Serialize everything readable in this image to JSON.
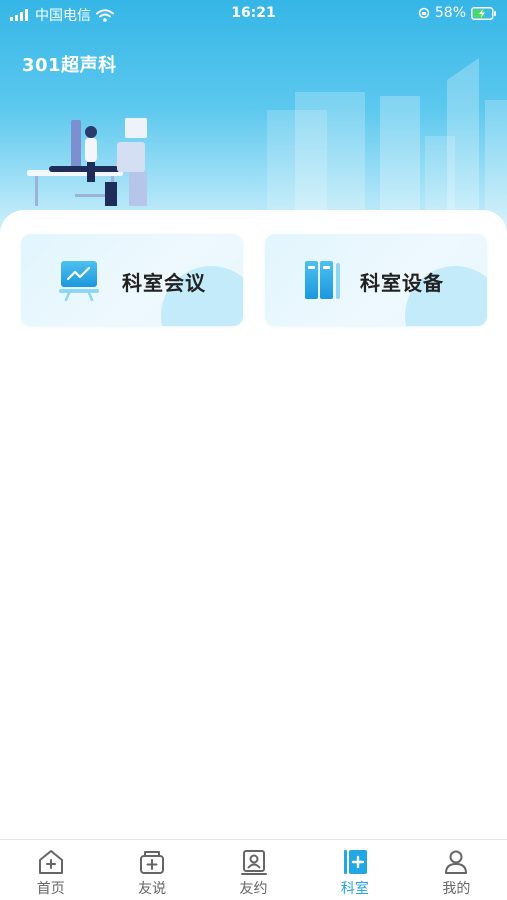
{
  "status_bar": {
    "carrier": "中国电信",
    "time": "16:21",
    "battery_percent": "58%",
    "battery_level": 0.58
  },
  "header": {
    "title": "301超声科"
  },
  "cards": [
    {
      "label": "科室会议",
      "icon": "presentation-chart-icon"
    },
    {
      "label": "科室设备",
      "icon": "binders-icon"
    }
  ],
  "tabbar": {
    "active_index": 3,
    "items": [
      {
        "label": "首页",
        "icon": "home-plus-icon"
      },
      {
        "label": "友说",
        "icon": "folder-plus-icon"
      },
      {
        "label": "友约",
        "icon": "contact-card-icon"
      },
      {
        "label": "科室",
        "icon": "department-book-icon"
      },
      {
        "label": "我的",
        "icon": "person-icon"
      }
    ]
  },
  "colors": {
    "accent": "#23a6e4",
    "header_top": "#35b6e6",
    "card_bg": "#e2f5fd",
    "tab_inactive": "#666666"
  }
}
